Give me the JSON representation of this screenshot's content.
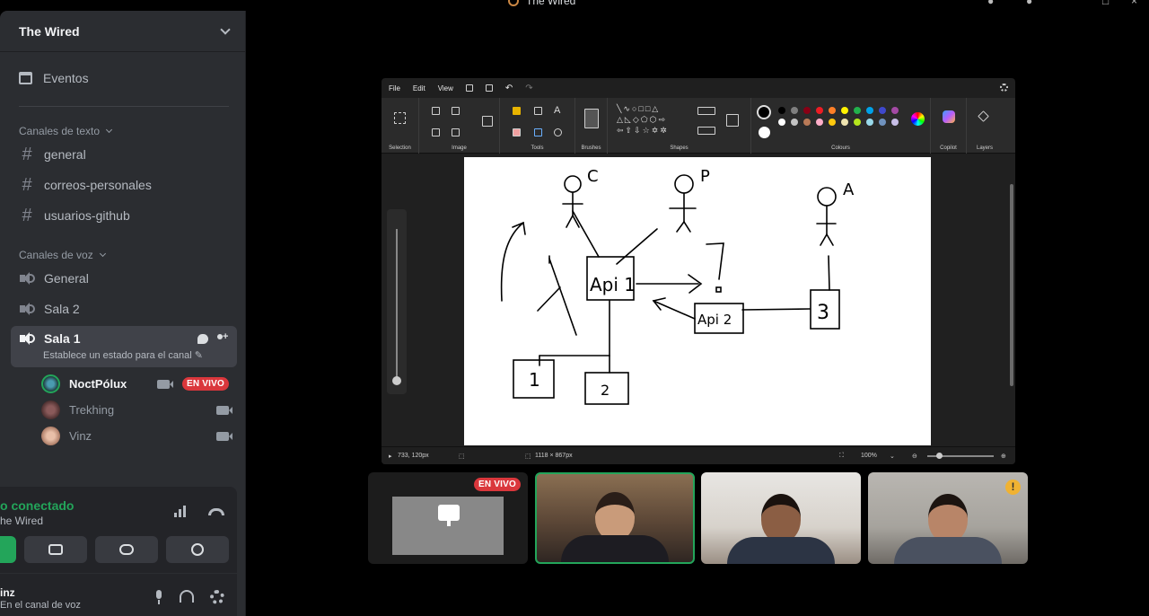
{
  "window": {
    "title": "The Wired"
  },
  "sidebar": {
    "server_name": "The Wired",
    "events_label": "Eventos",
    "text_category": "Canales de texto",
    "text_channels": [
      {
        "label": "general"
      },
      {
        "label": "correos-personales"
      },
      {
        "label": "usuarios-github"
      }
    ],
    "voice_category": "Canales de voz",
    "voice_channels": [
      {
        "label": "General"
      },
      {
        "label": "Sala 2"
      }
    ],
    "active_room": {
      "label": "Sala 1",
      "status": "Establece un estado para el canal"
    },
    "members": [
      {
        "name": "NoctPólux",
        "badge": "EN VIVO"
      },
      {
        "name": "Trekhing"
      },
      {
        "name": "Vinz"
      }
    ]
  },
  "voice_panel": {
    "status": "o conectado",
    "room": "he Wired"
  },
  "user_panel": {
    "name": "inz",
    "status": "En el canal de voz"
  },
  "paint": {
    "menu": [
      "File",
      "Edit",
      "View"
    ],
    "groups": [
      "Selection",
      "Image",
      "Tools",
      "Brushes",
      "Shapes",
      "Colours",
      "Copilot",
      "Layers"
    ],
    "status": {
      "cursor": "733, 120px",
      "size": "1118 × 867px",
      "zoom": "100%"
    },
    "drawing_labels": [
      "C",
      "P",
      "A",
      "Api 1",
      "Api 2",
      "3",
      "1",
      "2"
    ]
  },
  "tiles": {
    "live_badge": "EN VIVO",
    "warning": "!"
  },
  "colors": {
    "accent_green": "#23a55a",
    "live_red": "#da373c",
    "sidebar_bg": "#2b2d31"
  }
}
